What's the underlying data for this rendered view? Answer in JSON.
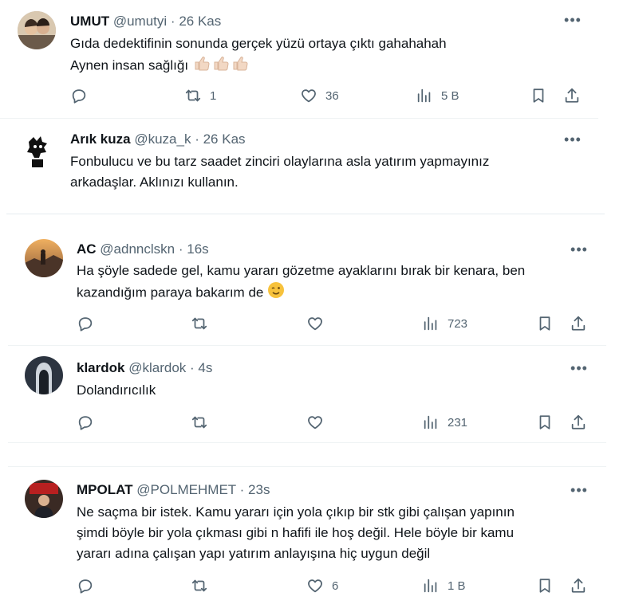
{
  "tweets": [
    {
      "name": "UMUT",
      "handle": "@umutyi",
      "time": "26 Kas",
      "lines": [
        "Gıda dedektifinin sonunda gerçek yüzü ortaya çıktı gahahahah",
        "Aynen insan sağlığı"
      ],
      "retweets": "1",
      "likes": "36",
      "views": "5 B",
      "emoji": "thumbs-up-emoji ×3"
    },
    {
      "name": "Arık kuza",
      "handle": "@kuza_k",
      "time": "26 Kas",
      "lines": [
        "Fonbulucu ve bu tarz saadet zinciri olaylarına asla yatırım yapmayınız",
        "arkadaşlar. Aklınızı kullanın."
      ]
    },
    {
      "name": "AC",
      "handle": "@adnnclskn",
      "time": "16s",
      "lines": [
        "Ha şöyle sadede gel, kamu yararı gözetme ayaklarını bırak bir kenara, ben",
        "kazandığım paraya bakarım de"
      ],
      "views": "723",
      "emoji": "winking-face-emoji"
    },
    {
      "name": "klardok",
      "handle": "@klardok",
      "time": "4s",
      "lines": [
        "Dolandırıcılık"
      ],
      "views": "231"
    },
    {
      "name": "MPOLAT",
      "handle": "@POLMEHMET",
      "time": "23s",
      "lines": [
        "Ne saçma bir istek. Kamu yararı için yola çıkıp bir stk gibi çalışan yapının",
        "şimdi böyle bir yola çıkması gibi n hafifi ile hoş değil. Hele böyle bir kamu",
        "yararı adına çalışan yapı yatırım anlayışına hiç uygun değil"
      ],
      "likes": "6",
      "views": "1 B"
    }
  ],
  "separator": "·",
  "more_label": "•••",
  "icons": [
    "reply-icon",
    "retweet-icon",
    "like-icon",
    "views-icon",
    "bookmark-icon",
    "share-icon"
  ],
  "colors": {
    "text": "#0f1419",
    "secondary": "#536471",
    "divider": "#eff3f4"
  }
}
